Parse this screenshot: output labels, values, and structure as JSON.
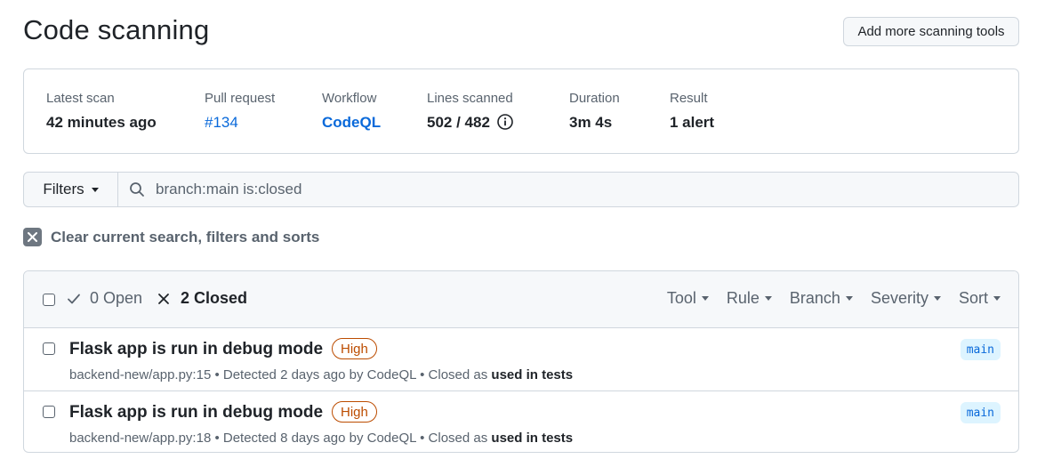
{
  "header": {
    "title": "Code scanning",
    "add_tools_label": "Add more scanning tools"
  },
  "scan": {
    "latest_scan": {
      "label": "Latest scan",
      "value": "42 minutes ago"
    },
    "pull_request": {
      "label": "Pull request",
      "value": "#134"
    },
    "workflow": {
      "label": "Workflow",
      "value": "CodeQL"
    },
    "lines_scanned": {
      "label": "Lines scanned",
      "value": "502 / 482"
    },
    "duration": {
      "label": "Duration",
      "value": "3m 4s"
    },
    "result": {
      "label": "Result",
      "value": "1 alert"
    }
  },
  "filters": {
    "button_label": "Filters",
    "search_value": "branch:main is:closed"
  },
  "clear_label": "Clear current search, filters and sorts",
  "results": {
    "open_label": "0 Open",
    "closed_label": "2 Closed",
    "filters": [
      "Tool",
      "Rule",
      "Branch",
      "Severity",
      "Sort"
    ],
    "alerts": [
      {
        "title": "Flask app is run in debug mode",
        "severity": "High",
        "meta_prefix": "backend-new/app.py:15 • Detected 2 days ago by CodeQL • Closed as ",
        "closed_reason": "used in tests",
        "branch": "main"
      },
      {
        "title": "Flask app is run in debug mode",
        "severity": "High",
        "meta_prefix": "backend-new/app.py:18 • Detected 8 days ago by CodeQL • Closed as ",
        "closed_reason": "used in tests",
        "branch": "main"
      }
    ]
  },
  "colors": {
    "accent": "#0969da",
    "severity_high": "#bc4c00",
    "border": "#d0d7de",
    "muted_text": "#59636e"
  }
}
